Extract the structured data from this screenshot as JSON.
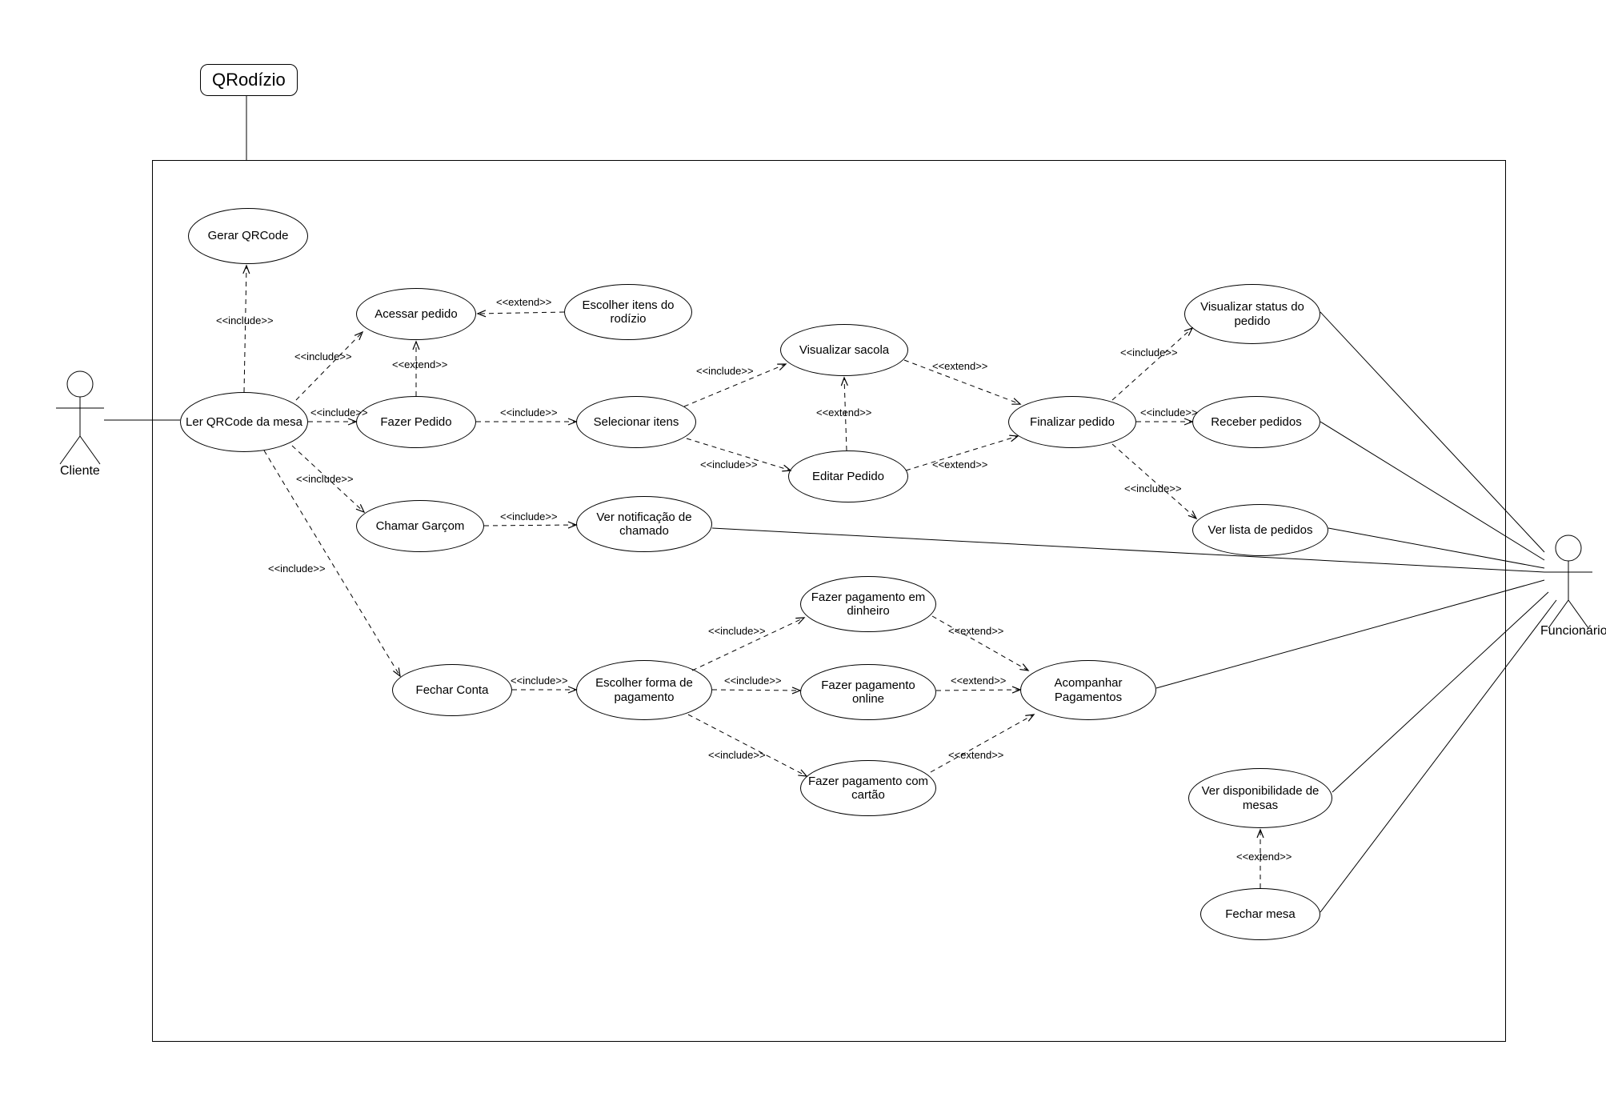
{
  "diagram_type": "UML Use Case Diagram",
  "system": {
    "name": "QRodízio"
  },
  "actors": {
    "cliente": "Cliente",
    "funcionario": "Funcionário"
  },
  "stereotypes": {
    "include": "<<include>>",
    "extend": "<<extend>>"
  },
  "use_cases": {
    "gerar_qrcode": "Gerar QRCode",
    "ler_qrcode": "Ler QRCode da mesa",
    "acessar_pedido": "Acessar pedido",
    "escolher_itens_rodizio": "Escolher itens do rodízio",
    "fazer_pedido": "Fazer Pedido",
    "selecionar_itens": "Selecionar itens",
    "visualizar_sacola": "Visualizar sacola",
    "editar_pedido": "Editar Pedido",
    "finalizar_pedido": "Finalizar pedido",
    "visualizar_status_pedido": "Visualizar status do pedido",
    "receber_pedidos": "Receber pedidos",
    "ver_lista_pedidos": "Ver lista de pedidos",
    "chamar_garcom": "Chamar Garçom",
    "ver_notificacao_chamado": "Ver notificação de chamado",
    "fechar_conta": "Fechar Conta",
    "escolher_forma_pagamento": "Escolher forma de pagamento",
    "fazer_pagamento_dinheiro": "Fazer pagamento em dinheiro",
    "fazer_pagamento_online": "Fazer pagamento online",
    "fazer_pagamento_cartao": "Fazer pagamento com cartão",
    "acompanhar_pagamentos": "Acompanhar Pagamentos",
    "ver_disponibilidade_mesas": "Ver disponibilidade de mesas",
    "fechar_mesa": "Fechar mesa"
  },
  "relationships": [
    {
      "from": "cliente",
      "to": "ler_qrcode",
      "type": "association"
    },
    {
      "from": "ler_qrcode",
      "to": "gerar_qrcode",
      "type": "include"
    },
    {
      "from": "ler_qrcode",
      "to": "acessar_pedido",
      "type": "include"
    },
    {
      "from": "ler_qrcode",
      "to": "fazer_pedido",
      "type": "include"
    },
    {
      "from": "ler_qrcode",
      "to": "chamar_garcom",
      "type": "include"
    },
    {
      "from": "ler_qrcode",
      "to": "fechar_conta",
      "type": "include"
    },
    {
      "from": "acessar_pedido",
      "to": "escolher_itens_rodizio",
      "type": "extend"
    },
    {
      "from": "fazer_pedido",
      "to": "acessar_pedido",
      "type": "extend"
    },
    {
      "from": "fazer_pedido",
      "to": "selecionar_itens",
      "type": "include"
    },
    {
      "from": "selecionar_itens",
      "to": "visualizar_sacola",
      "type": "include"
    },
    {
      "from": "selecionar_itens",
      "to": "editar_pedido",
      "type": "include"
    },
    {
      "from": "editar_pedido",
      "to": "visualizar_sacola",
      "type": "extend"
    },
    {
      "from": "visualizar_sacola",
      "to": "finalizar_pedido",
      "type": "extend"
    },
    {
      "from": "editar_pedido",
      "to": "finalizar_pedido",
      "type": "extend"
    },
    {
      "from": "finalizar_pedido",
      "to": "visualizar_status_pedido",
      "type": "include"
    },
    {
      "from": "finalizar_pedido",
      "to": "receber_pedidos",
      "type": "include"
    },
    {
      "from": "finalizar_pedido",
      "to": "ver_lista_pedidos",
      "type": "include"
    },
    {
      "from": "chamar_garcom",
      "to": "ver_notificacao_chamado",
      "type": "include"
    },
    {
      "from": "fechar_conta",
      "to": "escolher_forma_pagamento",
      "type": "include"
    },
    {
      "from": "escolher_forma_pagamento",
      "to": "fazer_pagamento_dinheiro",
      "type": "include"
    },
    {
      "from": "escolher_forma_pagamento",
      "to": "fazer_pagamento_online",
      "type": "include"
    },
    {
      "from": "escolher_forma_pagamento",
      "to": "fazer_pagamento_cartao",
      "type": "include"
    },
    {
      "from": "fazer_pagamento_dinheiro",
      "to": "acompanhar_pagamentos",
      "type": "extend"
    },
    {
      "from": "fazer_pagamento_online",
      "to": "acompanhar_pagamentos",
      "type": "extend"
    },
    {
      "from": "fazer_pagamento_cartao",
      "to": "acompanhar_pagamentos",
      "type": "extend"
    },
    {
      "from": "fechar_mesa",
      "to": "ver_disponibilidade_mesas",
      "type": "extend"
    },
    {
      "from": "funcionario",
      "to": "visualizar_status_pedido",
      "type": "association"
    },
    {
      "from": "funcionario",
      "to": "receber_pedidos",
      "type": "association"
    },
    {
      "from": "funcionario",
      "to": "ver_lista_pedidos",
      "type": "association"
    },
    {
      "from": "funcionario",
      "to": "ver_notificacao_chamado",
      "type": "association"
    },
    {
      "from": "funcionario",
      "to": "acompanhar_pagamentos",
      "type": "association"
    },
    {
      "from": "funcionario",
      "to": "ver_disponibilidade_mesas",
      "type": "association"
    },
    {
      "from": "funcionario",
      "to": "fechar_mesa",
      "type": "association"
    }
  ]
}
